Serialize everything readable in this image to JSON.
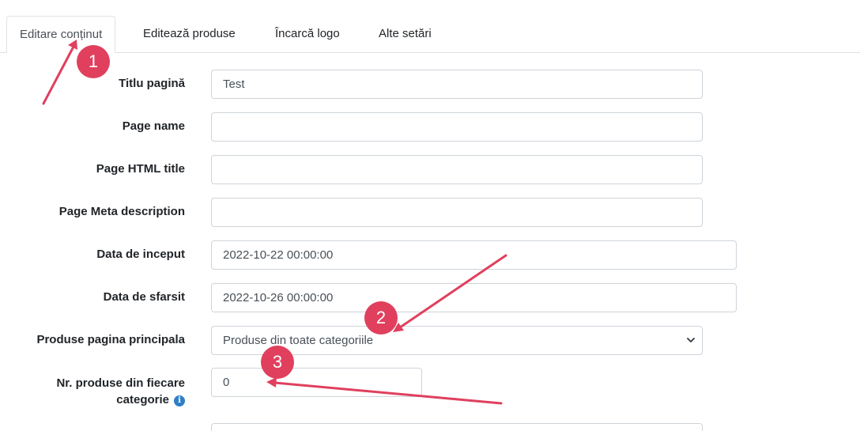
{
  "tabs": [
    {
      "label": "Editare conținut",
      "active": true
    },
    {
      "label": "Editează produse",
      "active": false
    },
    {
      "label": "Încarcă logo",
      "active": false
    },
    {
      "label": "Alte setări",
      "active": false
    }
  ],
  "form": {
    "titlu_pagina": {
      "label": "Titlu pagină",
      "value": "Test"
    },
    "page_name": {
      "label": "Page name",
      "value": ""
    },
    "page_html_title": {
      "label": "Page HTML title",
      "value": ""
    },
    "page_meta_description": {
      "label": "Page Meta description",
      "value": ""
    },
    "data_inceput": {
      "label": "Data de inceput",
      "value": "2022-10-22 00:00:00"
    },
    "data_sfarsit": {
      "label": "Data de sfarsit",
      "value": "2022-10-26 00:00:00"
    },
    "produse_pagina_principala": {
      "label": "Produse pagina principala",
      "value": "Produse din toate categoriile"
    },
    "nr_produse": {
      "label": "Nr. produse din fiecare categorie",
      "value": "0"
    }
  },
  "annotations": {
    "badge_1": "1",
    "badge_2": "2",
    "badge_3": "3",
    "color": "#e0405e"
  },
  "icons": {
    "info": "info-icon",
    "select": "chevron-down-icon"
  }
}
